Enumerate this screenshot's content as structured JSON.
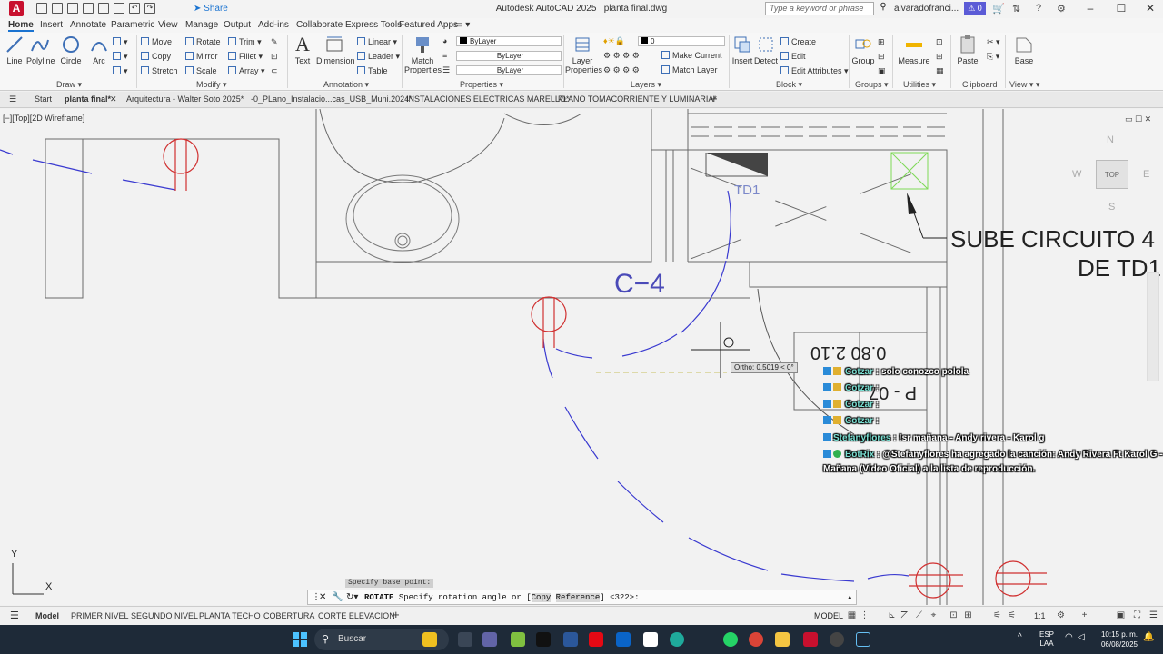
{
  "titlebar": {
    "app_title": "Autodesk AutoCAD 2025",
    "file_name": "planta final.dwg",
    "share_label": "Share",
    "search_placeholder": "Type a keyword or phrase",
    "user": "alvaradofranci...",
    "notifications": "0",
    "logo": "A"
  },
  "ribbon_tabs": [
    "Home",
    "Insert",
    "Annotate",
    "Parametric",
    "View",
    "Manage",
    "Output",
    "Add-ins",
    "Collaborate",
    "Express Tools",
    "Featured Apps"
  ],
  "ribbon": {
    "draw": {
      "label": "Draw",
      "tools": [
        "Line",
        "Polyline",
        "Circle",
        "Arc"
      ]
    },
    "modify": {
      "label": "Modify",
      "col1": [
        "Move",
        "Copy",
        "Stretch"
      ],
      "col2": [
        "Rotate",
        "Mirror",
        "Scale"
      ],
      "col3": [
        "Trim",
        "Fillet",
        "Array"
      ]
    },
    "annotation": {
      "label": "Annotation",
      "big": [
        "Text",
        "Dimension"
      ],
      "small": [
        "Linear",
        "Leader",
        "Table"
      ]
    },
    "properties": {
      "label": "Properties",
      "match": "Match Properties",
      "color": "ByLayer",
      "linetype": "ByLayer",
      "lineweight": "ByLayer"
    },
    "layers": {
      "label": "Layers",
      "big": "Layer Properties",
      "current_layer": "0",
      "make_current": "Make Current",
      "match_layer": "Match Layer"
    },
    "block": {
      "label": "Block",
      "insert": "Insert",
      "detect": "Detect",
      "small": [
        "Create",
        "Edit",
        "Edit Attributes"
      ]
    },
    "groups": {
      "label": "Groups",
      "tool": "Group"
    },
    "utilities": {
      "label": "Utilities",
      "tool": "Measure"
    },
    "clipboard": {
      "label": "Clipboard",
      "tool": "Paste"
    },
    "view": {
      "label": "View",
      "tool": "Base"
    }
  },
  "file_tabs": [
    "Start",
    "planta final*",
    "Arquitectura - Walter Soto 2025*",
    "-0_PLano_Instalacio...cas_USB_Muni.2024*",
    "INSTALACIONES ELECTRICAS MARELLO*",
    "PLANO TOMACORRIENTE Y LUMINARIA*"
  ],
  "viewport": {
    "label": "[−][Top][2D Wireframe]",
    "cube_top": "TOP",
    "cube_n": "N",
    "cube_s": "S",
    "cube_e": "E",
    "cube_w": "W"
  },
  "drawing": {
    "sube_line1": "SUBE CIRCUITO 4",
    "sube_line2": "DE TD1",
    "td1": "TD1",
    "c4": "C−4",
    "mirror_top": "0.80  2.10",
    "mirror_bot": "P - 07",
    "ortho": "Ortho: 0.5019 < 0°"
  },
  "chat": [
    {
      "user": "Cotzar",
      "msg": ": solo conozco polola"
    },
    {
      "user": "Cotzar",
      "msg": ":"
    },
    {
      "user": "Cotzar",
      "msg": ":"
    },
    {
      "user": "Cotzar",
      "msg": ":"
    },
    {
      "user": "Stefanyflores",
      "msg": ": !sr mañana - Andy rivera - Karol g"
    },
    {
      "user": "BotRix",
      "msg": ": @Stefanyflores ha agregado la canción: Andy Rivera Ft Karol G -"
    },
    {
      "user": "",
      "msg": "Mañana (Video Oficial) a la lista de reproducción."
    }
  ],
  "command": {
    "previous": "Specify base point:",
    "keyword": "ROTATE",
    "prompt": "Specify rotation angle or [",
    "opt1": "Copy",
    "opt2": "Reference",
    "suffix": "] <322>:"
  },
  "layout_tabs": [
    "Model",
    "PRIMER NIVEL",
    "SEGUNDO NIVEL",
    "PLANTA TECHO",
    "COBERTURA",
    "CORTE ELEVACION"
  ],
  "status": {
    "space": "MODEL",
    "scale": "1:1"
  },
  "ucs": {
    "x": "X",
    "y": "Y"
  },
  "taskbar": {
    "search": "Buscar",
    "lang1": "ESP",
    "lang2": "LAA",
    "time": "10:15 p. m.",
    "date": "06/08/2025"
  }
}
